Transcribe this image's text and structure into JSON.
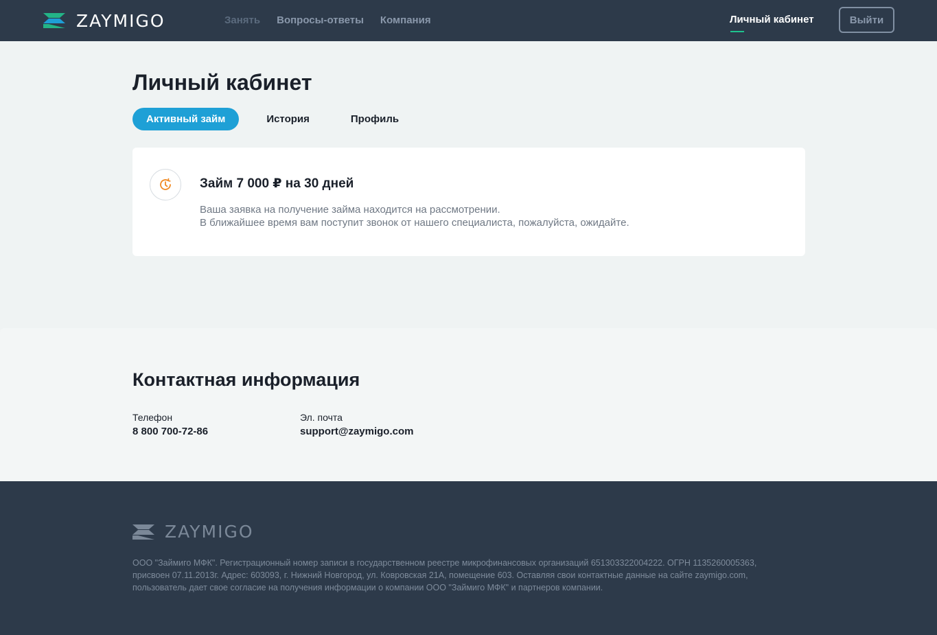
{
  "header": {
    "logo_text": "ZAYMIGO",
    "nav": [
      "Занять",
      "Вопросы-ответы",
      "Компания"
    ],
    "cabinet_link": "Личный кабинет",
    "logout_label": "Выйти"
  },
  "main": {
    "title": "Личный кабинет",
    "tabs": [
      {
        "label": "Активный займ",
        "active": true
      },
      {
        "label": "История",
        "active": false
      },
      {
        "label": "Профиль",
        "active": false
      }
    ],
    "loan_card": {
      "icon": "clock-refresh-icon",
      "title": "Займ 7 000 ₽ на 30 дней",
      "line1": "Ваша заявка на получение займа находится на рассмотрении.",
      "line2": "В ближайшее время вам поступит звонок от нашего специалиста, пожалуйста, ожидайте."
    }
  },
  "contacts": {
    "title": "Контактная информация",
    "phone_label": "Телефон",
    "phone_value": "8 800 700-72-86",
    "email_label": "Эл. почта",
    "email_value": "support@zaymigo.com"
  },
  "footer": {
    "logo_text": "ZAYMIGO",
    "legal_line1": "ООО \"Займиго МФК\". Регистрационный номер записи в государственном реестре микрофинансовых организаций 651303322004222. ОГРН 1135260005363,",
    "legal_line2": "присвоен 07.11.2013г. Адрес: 603093, г. Нижний Новгород, ул. Ковровская 21А, помещение 603. Оставляя свои контактные данные на сайте zaymigo.com,",
    "legal_line3": "пользователь дает свое согласие на получения информации о компании ООО \"Займиго МФК\" и партнеров компании."
  },
  "colors": {
    "header_bg": "#2d3a4a",
    "accent_blue": "#1ea0d6",
    "accent_green": "#1fc38e",
    "icon_orange": "#f08a24"
  }
}
